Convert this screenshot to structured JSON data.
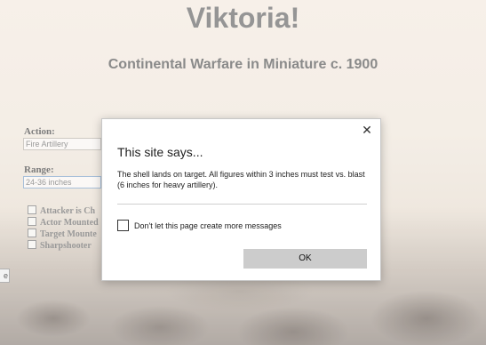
{
  "page": {
    "title": "Viktoria!",
    "subtitle": "Continental Warfare in Miniature c. 1900"
  },
  "form": {
    "action_label": "Action:",
    "action_value": "Fire Artillery",
    "range_label": "Range:",
    "range_value": "24-36 inches",
    "checkboxes": [
      {
        "label": "Attacker is Ch",
        "checked": false
      },
      {
        "label": "Actor Mounted",
        "checked": false
      },
      {
        "label": "Target Mounte",
        "checked": false
      },
      {
        "label": "Sharpshooter",
        "checked": false
      }
    ],
    "edge_button_label": "e"
  },
  "dialog": {
    "title": "This site says...",
    "message": "The shell lands on target. All figures within 3 inches must test vs. blast (6 inches for heavy artillery).",
    "checkbox_label": "Don't let this page create more messages",
    "checkbox_checked": false,
    "ok_label": "OK",
    "close_symbol": "✕"
  }
}
